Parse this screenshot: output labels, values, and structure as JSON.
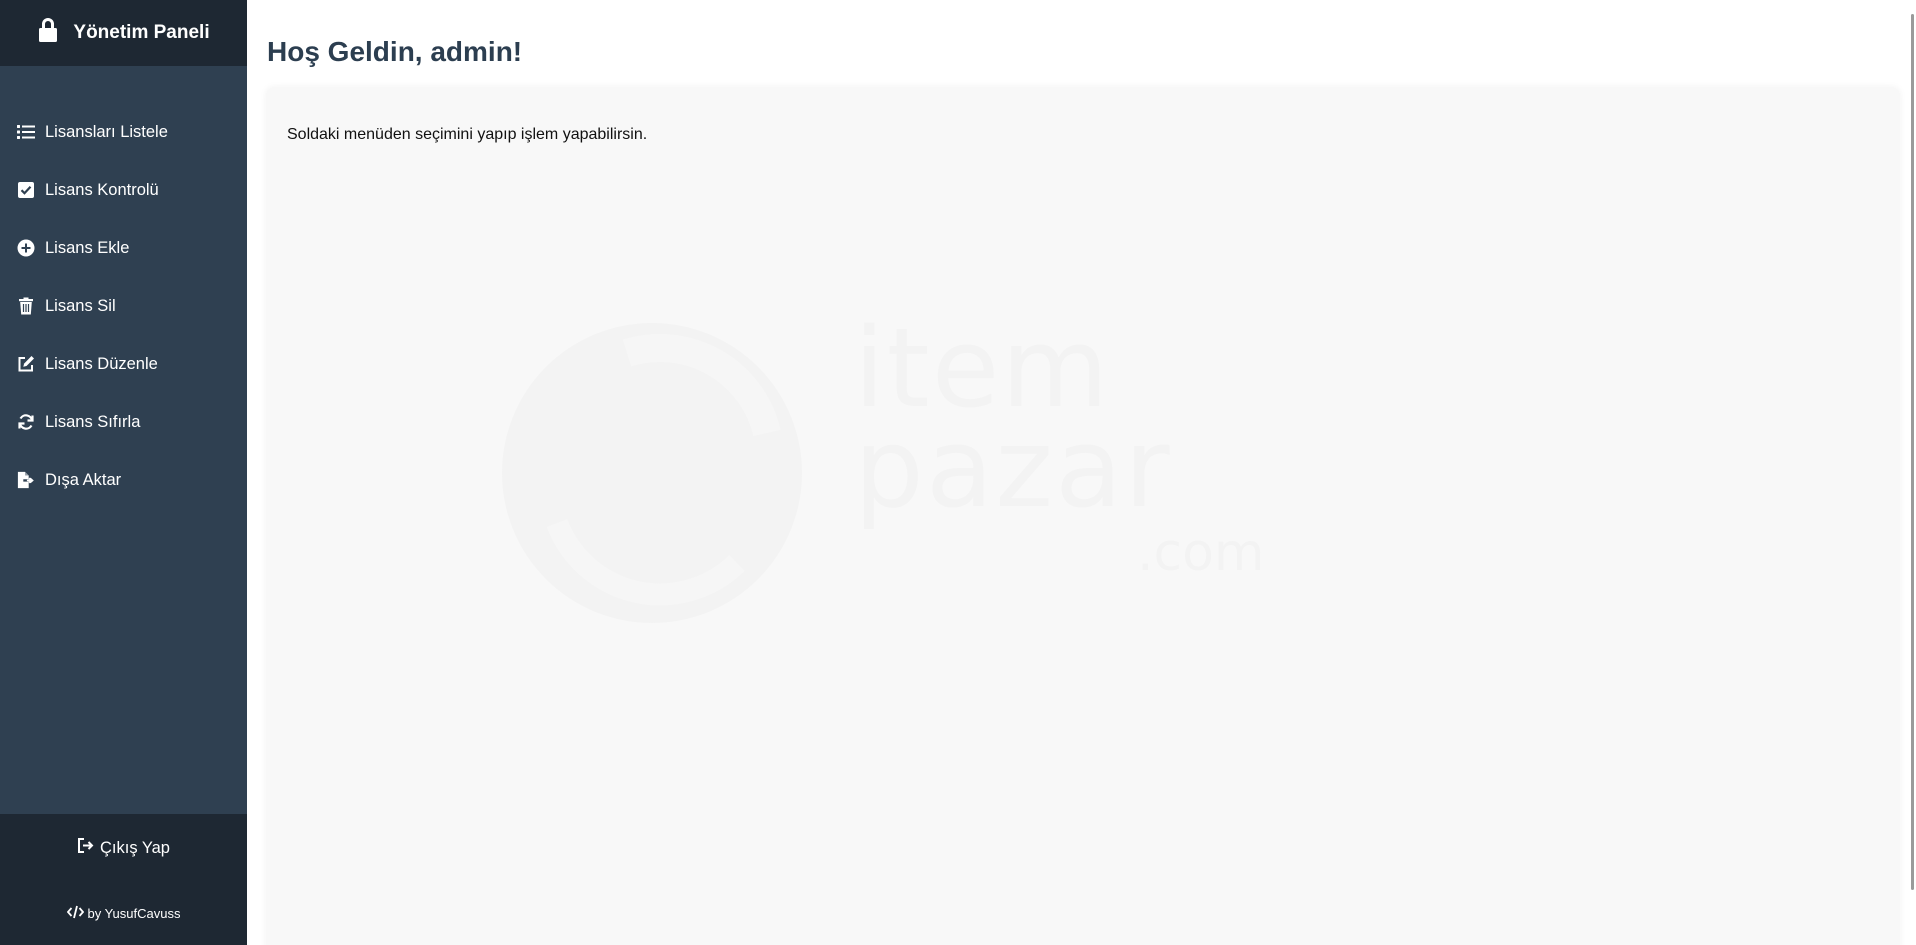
{
  "sidebar": {
    "title": "Yönetim Paneli",
    "title_icon": "lock-icon",
    "items": [
      {
        "label": "Lisansları Listele",
        "icon": "list-icon"
      },
      {
        "label": "Lisans Kontrolü",
        "icon": "check-square-icon"
      },
      {
        "label": "Lisans Ekle",
        "icon": "plus-circle-icon"
      },
      {
        "label": "Lisans Sil",
        "icon": "trash-icon"
      },
      {
        "label": "Lisans Düzenle",
        "icon": "edit-icon"
      },
      {
        "label": "Lisans Sıfırla",
        "icon": "refresh-icon"
      },
      {
        "label": "Dışa Aktar",
        "icon": "file-export-icon"
      }
    ],
    "logout_label": "Çıkış Yap",
    "credit": "by YusufCavuss"
  },
  "main": {
    "title": "Hoş Geldin, admin!",
    "intro": "Soldaki menüden seçimini yapıp işlem yapabilirsin.",
    "watermark": {
      "line1": "item",
      "line2": "pazar",
      "suffix": ".com"
    }
  },
  "colors": {
    "sidebar_bg": "#2f4051",
    "sidebar_header_bg": "#1e2833",
    "title_color": "#2c3e50",
    "card_bg": "#f8f8f8"
  }
}
